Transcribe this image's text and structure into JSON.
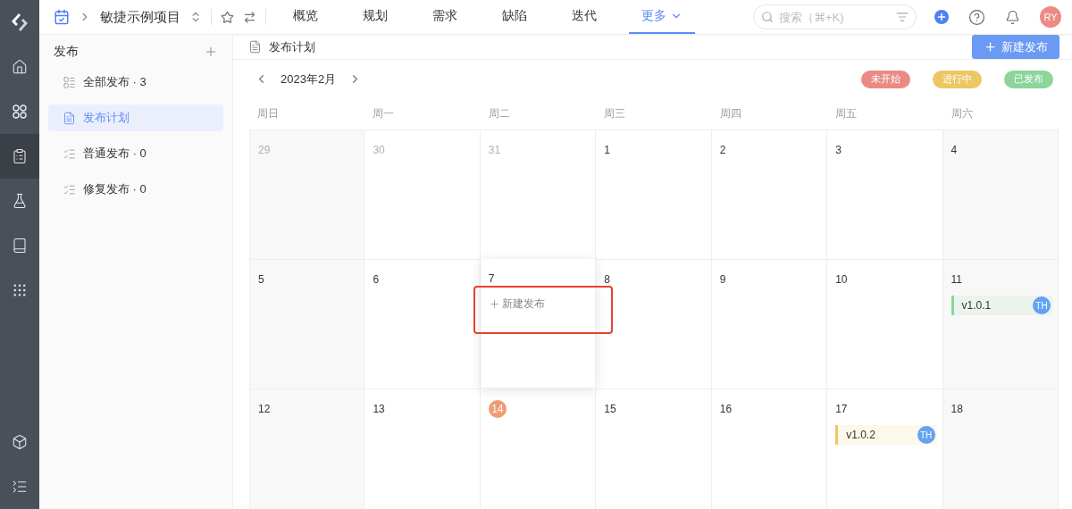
{
  "rail": {
    "items": [
      {
        "kind": "home",
        "selected": false
      },
      {
        "kind": "apps",
        "selected": false
      },
      {
        "kind": "release",
        "selected": true
      },
      {
        "kind": "flask",
        "selected": false
      },
      {
        "kind": "book",
        "selected": false
      },
      {
        "kind": "grid",
        "selected": false
      }
    ],
    "bottom": [
      {
        "kind": "box",
        "selected": false
      },
      {
        "kind": "collapse",
        "selected": false
      }
    ]
  },
  "topbar": {
    "project": "敏捷示例项目",
    "tabs": [
      {
        "label": "概览",
        "selected": false
      },
      {
        "label": "规划",
        "selected": false
      },
      {
        "label": "需求",
        "selected": false
      },
      {
        "label": "缺陷",
        "selected": false
      },
      {
        "label": "迭代",
        "selected": false
      },
      {
        "label": "更多",
        "selected": true
      }
    ],
    "search": {
      "placeholder": "搜索（⌘+K)"
    },
    "avatar": "RY"
  },
  "sidebar": {
    "title": "发布",
    "items": [
      {
        "label": "全部发布 · 3",
        "selected": false
      },
      {
        "label": "发布计划",
        "selected": true
      },
      {
        "label": "普通发布 · 0",
        "selected": false
      },
      {
        "label": "修复发布 · 0",
        "selected": false
      }
    ]
  },
  "main": {
    "title": "发布计划",
    "new_button": "新建发布",
    "month": "2023年2月",
    "legend": [
      {
        "label": "未开始",
        "color": "#eb8a85"
      },
      {
        "label": "进行中",
        "color": "#ecc765"
      },
      {
        "label": "已发布",
        "color": "#8dd59a"
      }
    ],
    "weekdays": [
      "周日",
      "周一",
      "周二",
      "周三",
      "周四",
      "周五",
      "周六"
    ],
    "weeks": [
      [
        {
          "day": "29",
          "muted": true
        },
        {
          "day": "30",
          "muted": true
        },
        {
          "day": "31",
          "muted": true
        },
        {
          "day": "1"
        },
        {
          "day": "2"
        },
        {
          "day": "3"
        },
        {
          "day": "4"
        }
      ],
      [
        {
          "day": "5"
        },
        {
          "day": "6"
        },
        {
          "day": "7",
          "hover": true,
          "add_label": "新建发布",
          "highlighted": true
        },
        {
          "day": "8"
        },
        {
          "day": "9"
        },
        {
          "day": "10"
        },
        {
          "day": "11",
          "events": [
            {
              "title": "v1.0.1",
              "color": "#8dd59a",
              "assignee": "TH"
            }
          ]
        }
      ],
      [
        {
          "day": "12"
        },
        {
          "day": "13"
        },
        {
          "day": "14",
          "today": true
        },
        {
          "day": "15"
        },
        {
          "day": "16"
        },
        {
          "day": "17",
          "events": [
            {
              "title": "v1.0.2",
              "color": "#ecc765",
              "assignee": "TH"
            }
          ]
        },
        {
          "day": "18"
        }
      ]
    ]
  }
}
